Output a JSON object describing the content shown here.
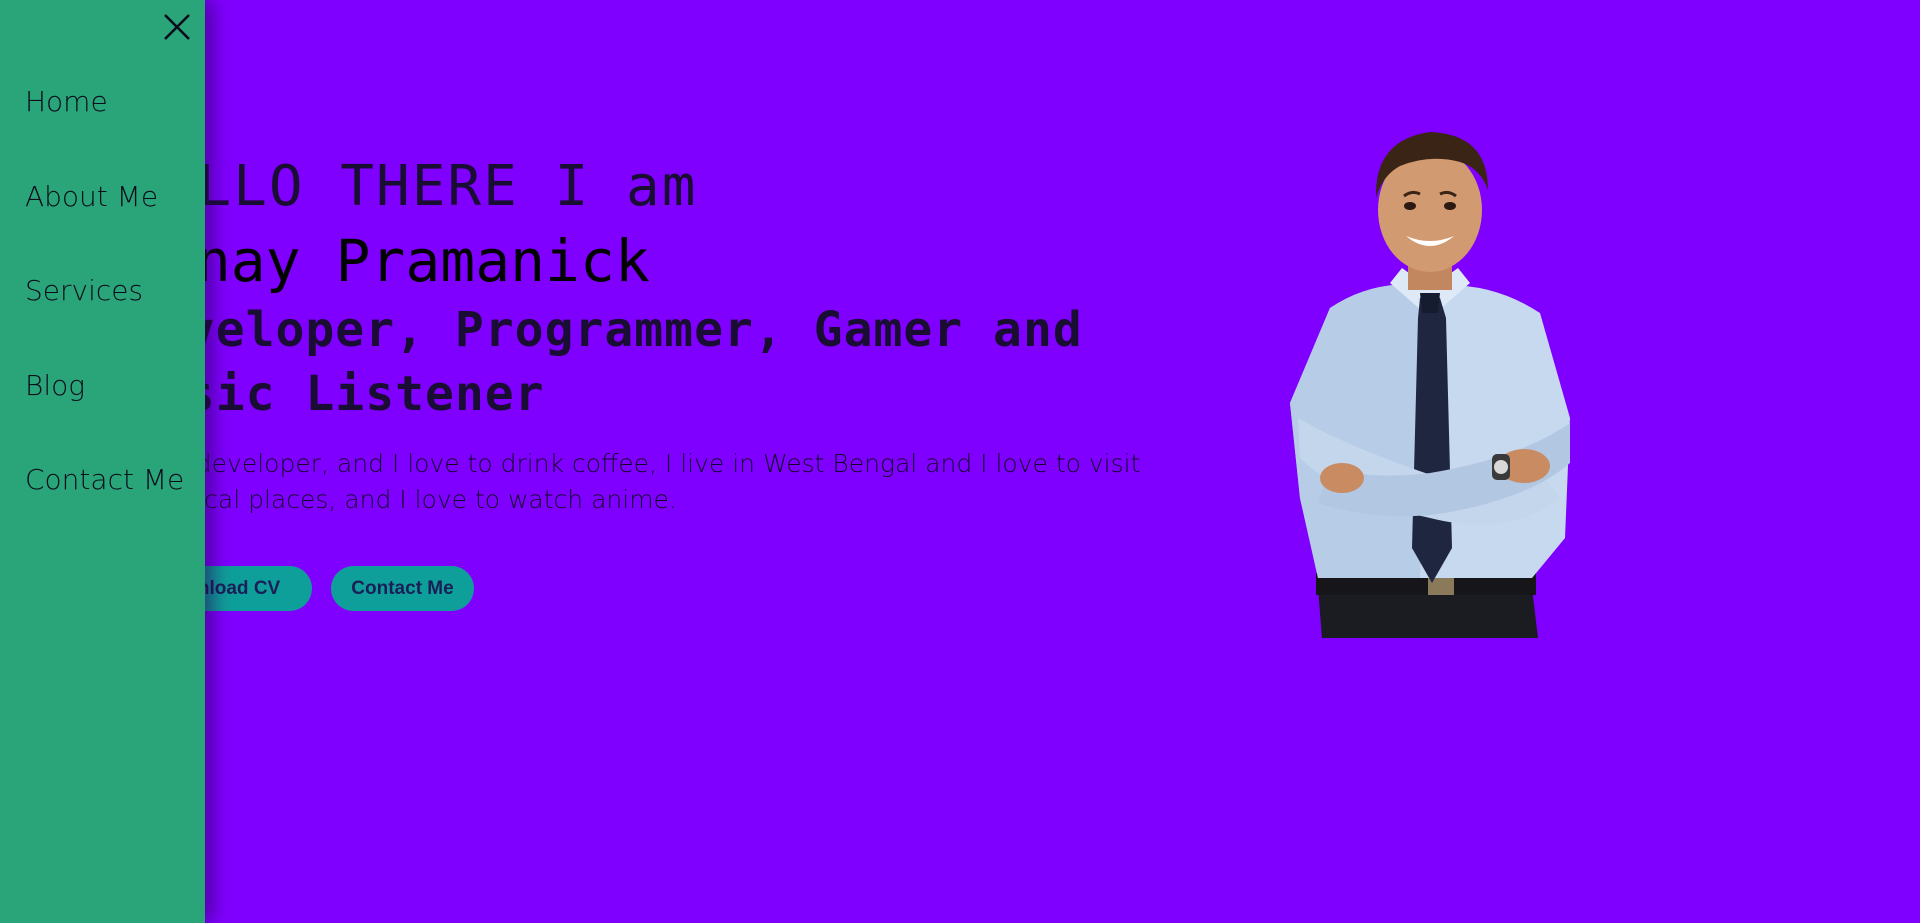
{
  "sidenav": {
    "items": [
      {
        "label": "Home"
      },
      {
        "label": "About Me"
      },
      {
        "label": "Services"
      },
      {
        "label": "Blog"
      },
      {
        "label": "Contact Me"
      }
    ],
    "close_icon": "close-icon"
  },
  "hero": {
    "greeting": "HELLO THERE I am",
    "name": "Tanay Pramanick",
    "roles": "Developer, Programmer, Gamer and Music Listener",
    "bio": "I'm a developer, and I love to drink coffee, I live in West Bengal and I love to visit historical places, and I love to watch anime.",
    "buttons": {
      "download_cv": "Download CV",
      "contact": "Contact Me"
    }
  },
  "colors": {
    "background": "#8000ff",
    "sidenav": "#2aa57a",
    "button": "#0f9f9a"
  }
}
